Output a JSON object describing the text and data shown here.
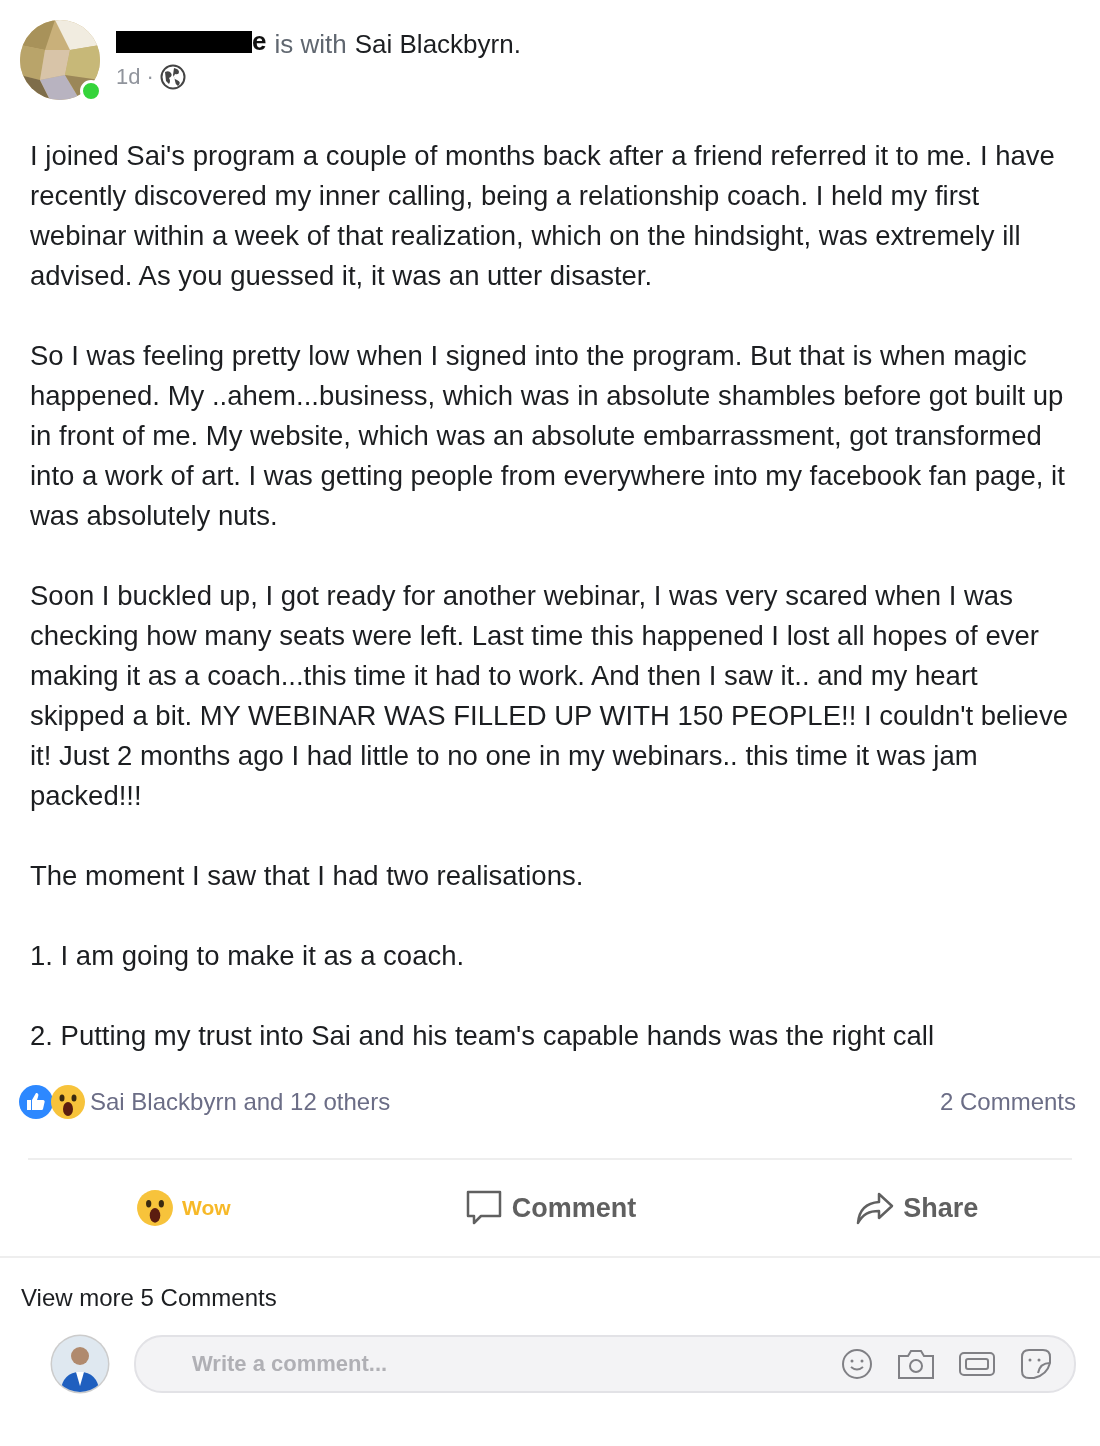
{
  "post": {
    "author": {
      "name_visible": "e",
      "online": true
    },
    "with_text": "is with",
    "tagged": "Sai Blackbyrn.",
    "time": "1d",
    "separator": "·",
    "paragraphs": [
      "I joined Sai's program a couple of months back after a friend referred it to me. I have recently discovered my inner calling, being a relationship coach. I held my first webinar within a week of that realization, which on the hindsight, was extremely ill advised. As you guessed it, it was an utter disaster.",
      "So I was feeling pretty low when I signed into the program. But that is when magic happened. My ..ahem...business, which was in absolute shambles before got built up in front of me. My website, which was an absolute embarrassment, got transformed into a work of art. I was getting people from everywhere into my facebook fan page, it was absolutely nuts.",
      "Soon I buckled up, I got ready for another webinar, I was very scared when I was checking how many seats were left. Last time this happened I lost all hopes of ever making it as a coach...this time it had to work. And then I saw it.. and my heart skipped a bit. MY WEBINAR WAS FILLED UP WITH 150 PEOPLE!! I couldn't believe it! Just 2 months ago I had little to no one in my webinars.. this time it was jam packed!!!",
      "The moment I saw that I had two realisations.",
      "1. I am going to make it as a coach.",
      "2. Putting my trust into Sai and his team's capable hands was the right call"
    ],
    "reactions": {
      "kinds": [
        {
          "kind": "like"
        },
        {
          "kind": "wow"
        }
      ],
      "summary": "Sai Blackbyrn and 12 others",
      "comments": "2 Comments"
    },
    "actions": [
      {
        "kind": "wow",
        "label": "Wow",
        "selected": true
      },
      {
        "kind": "comment",
        "label": "Comment",
        "selected": false
      },
      {
        "kind": "share",
        "label": "Share",
        "selected": false
      }
    ],
    "view_more": "View more 5 Comments",
    "comment_box": {
      "placeholder": "Write a comment...",
      "tools": [
        {
          "kind": "emoji"
        },
        {
          "kind": "camera"
        },
        {
          "kind": "gif"
        },
        {
          "kind": "sticker"
        }
      ]
    }
  }
}
